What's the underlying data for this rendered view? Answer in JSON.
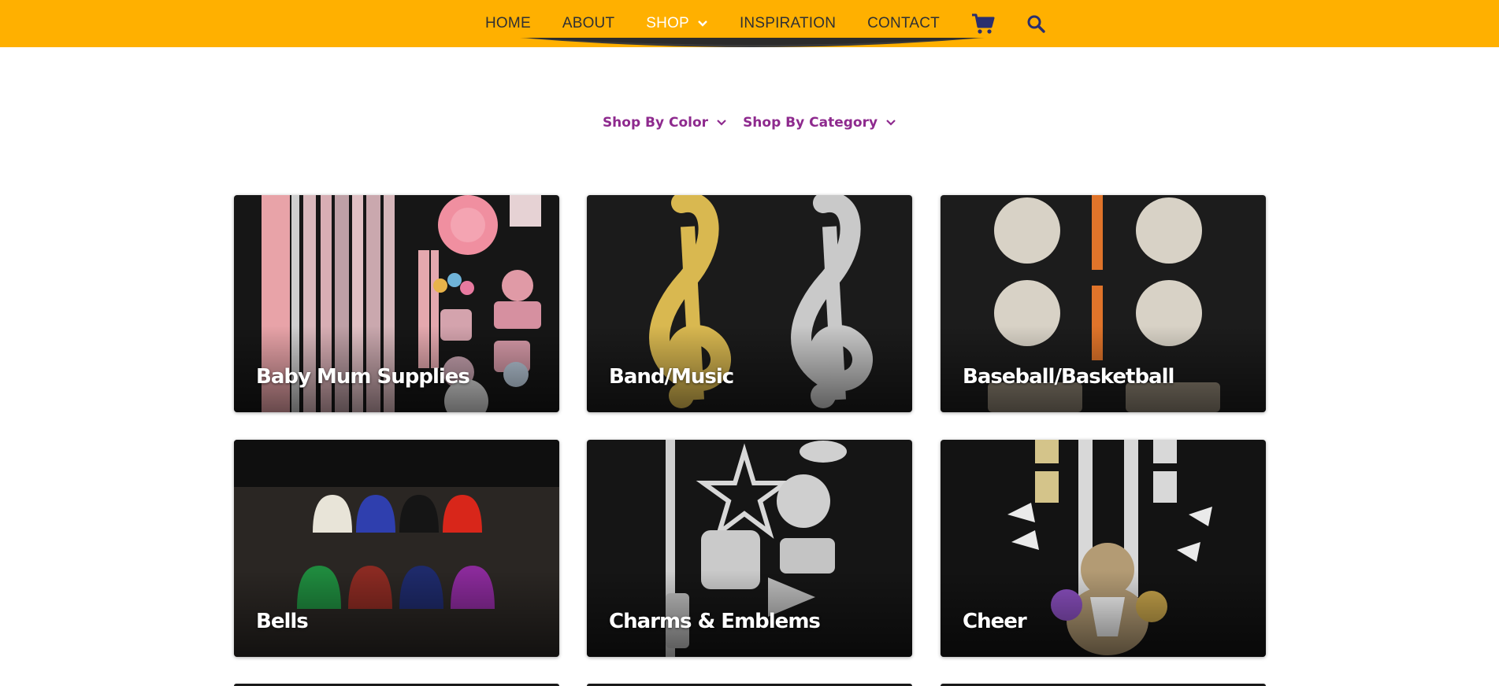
{
  "nav": {
    "items": [
      {
        "label": "HOME"
      },
      {
        "label": "ABOUT"
      },
      {
        "label": "SHOP"
      },
      {
        "label": "INSPIRATION"
      },
      {
        "label": "CONTACT"
      }
    ],
    "cart_icon": "shopping-cart-icon",
    "search_icon": "search-icon"
  },
  "filters": {
    "color_label": "Shop By Color",
    "category_label": "Shop By Category"
  },
  "categories": [
    {
      "label": "Baby Mum Supplies"
    },
    {
      "label": "Band/Music"
    },
    {
      "label": "Baseball/Basketball"
    },
    {
      "label": "Bells"
    },
    {
      "label": "Charms & Emblems"
    },
    {
      "label": "Cheer"
    }
  ],
  "colors": {
    "header_bg": "#ffb000",
    "nav_text": "#2f3033",
    "nav_active": "#ffffff",
    "icon_color": "#2a2f6e",
    "filter_text": "#8e2a8e"
  }
}
